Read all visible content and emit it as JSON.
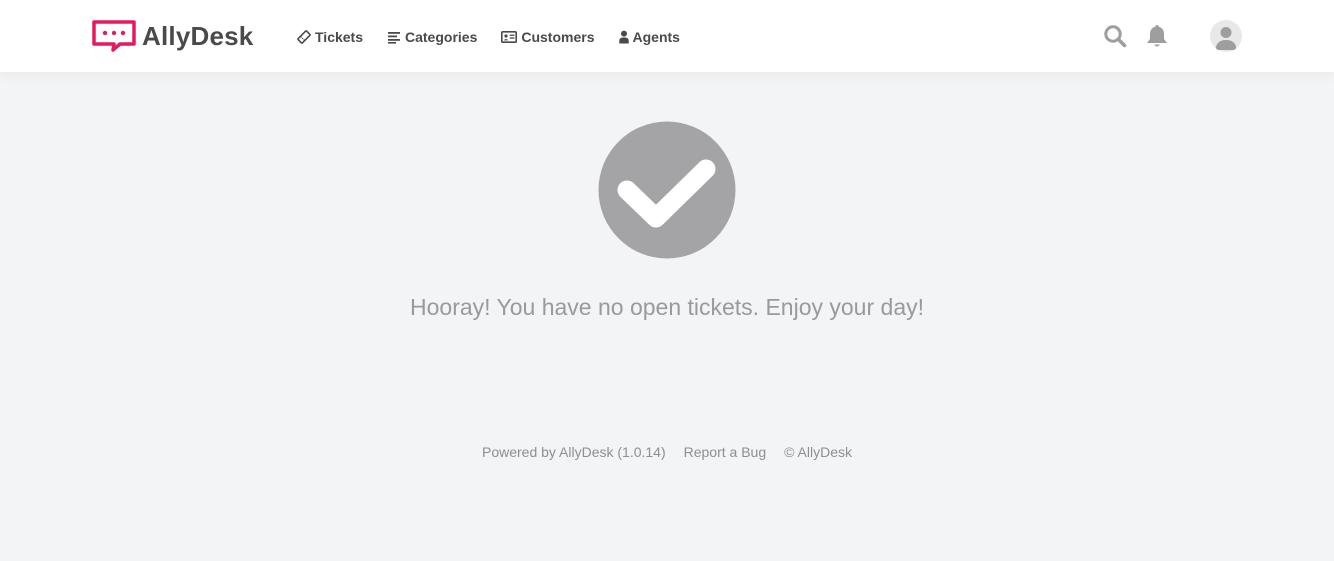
{
  "brand": {
    "name": "AllyDesk",
    "color": "#e5195f"
  },
  "nav": {
    "items": [
      {
        "label": "Tickets",
        "icon": "ticket-icon"
      },
      {
        "label": "Categories",
        "icon": "list-icon"
      },
      {
        "label": "Customers",
        "icon": "id-card-icon"
      },
      {
        "label": "Agents",
        "icon": "user-icon"
      }
    ]
  },
  "header_actions": {
    "search_icon": "search-icon",
    "notifications_icon": "bell-icon",
    "avatar_icon": "user-avatar-icon"
  },
  "empty_state": {
    "icon": "check-circle-icon",
    "message": "Hooray! You have no open tickets. Enjoy your day!"
  },
  "footer": {
    "powered_by": "Powered by AllyDesk (1.0.14)",
    "report_bug": "Report a Bug",
    "copyright": "© AllyDesk"
  },
  "colors": {
    "nav_text": "#4a4a4a",
    "icon_gray": "#9e9e9e",
    "check_gray": "#a4a4a6",
    "background": "#f3f4f6"
  }
}
